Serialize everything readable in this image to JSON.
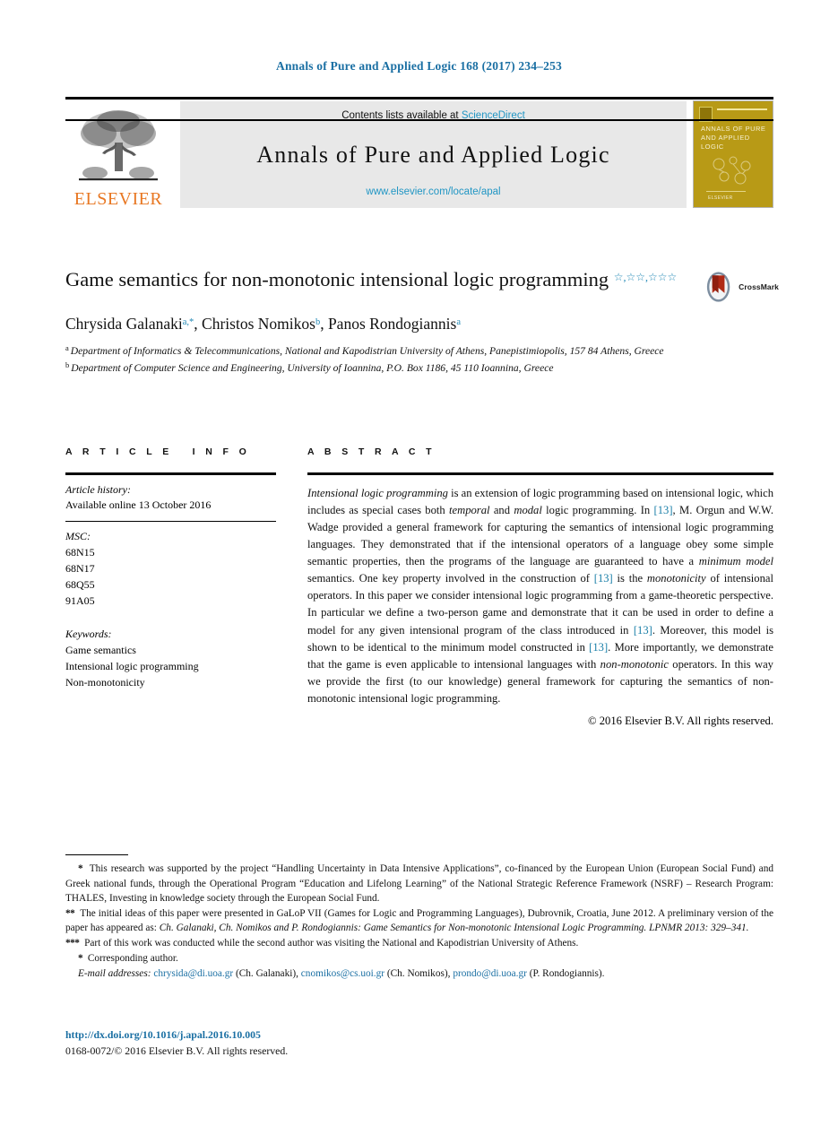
{
  "running_head": "Annals of Pure and Applied Logic 168 (2017) 234–253",
  "masthead": {
    "publisher_logo_name": "elsevier-tree-logo",
    "publisher_word": "ELSEVIER",
    "contents_prefix": "Contents lists available at ",
    "contents_link": "ScienceDirect",
    "journal_name": "Annals of Pure and Applied Logic",
    "journal_url": "www.elsevier.com/locate/apal",
    "cover": {
      "title": "Annals of Pure and Applied Logic",
      "footer_mark": "ELSEVIER",
      "background_color": "#b89a16"
    },
    "accent_link_color": "#2196c4"
  },
  "article": {
    "title": "Game semantics for non-monotonic intensional logic programming",
    "title_footnote_marks": "☆,☆☆,☆☆☆",
    "authors": [
      {
        "name": "Chrysida Galanaki",
        "marks": "a,*"
      },
      {
        "name": "Christos Nomikos",
        "marks": "b"
      },
      {
        "name": "Panos Rondogiannis",
        "marks": "a"
      }
    ],
    "affiliations": [
      {
        "mark": "a",
        "text": "Department of Informatics & Telecommunications, National and Kapodistrian University of Athens, Panepistimiopolis, 157 84 Athens, Greece"
      },
      {
        "mark": "b",
        "text": "Department of Computer Science and Engineering, University of Ioannina, P.O. Box 1186, 45 110 Ioannina, Greece"
      }
    ]
  },
  "crossmark": {
    "label": "CrossMark",
    "icon_name": "crossmark-logo"
  },
  "info_column": {
    "heading": "ARTICLE INFO",
    "history_label": "Article history:",
    "history_value": "Available online 13 October 2016",
    "msc_label": "MSC:",
    "msc_codes": [
      "68N15",
      "68N17",
      "68Q55",
      "91A05"
    ],
    "keywords_label": "Keywords:",
    "keywords": [
      "Game semantics",
      "Intensional logic programming",
      "Non-monotonicity"
    ]
  },
  "abstract_column": {
    "heading": "ABSTRACT",
    "paragraph_html": "<em>Intensional logic programming</em> is an extension of logic programming based on intensional logic, which includes as special cases both <em>temporal</em> and <em>modal</em> logic programming. In <span class=\"ref\">[13]</span>, M. Orgun and W.W. Wadge provided a general framework for capturing the semantics of intensional logic programming languages. They demonstrated that if the intensional operators of a language obey some simple semantic properties, then the programs of the language are guaranteed to have a <em>minimum model</em> semantics. One key property involved in the construction of <span class=\"ref\">[13]</span> is the <em>monotonicity</em> of intensional operators. In this paper we consider intensional logic programming from a game-theoretic perspective. In particular we define a two-person game and demonstrate that it can be used in order to define a model for any given intensional program of the class introduced in <span class=\"ref\">[13]</span>. Moreover, this model is shown to be identical to the minimum model constructed in <span class=\"ref\">[13]</span>. More importantly, we demonstrate that the game is even applicable to intensional languages with <em>non-monotonic</em> operators. In this way we provide the first (to our knowledge) general framework for capturing the semantics of non-monotonic intensional logic programming.",
    "copyright": "© 2016 Elsevier B.V. All rights reserved."
  },
  "footnotes": [
    {
      "mark": "*",
      "html": "This research was supported by the project “Handling Uncertainty in Data Intensive Applications”, co-financed by the European Union (European Social Fund) and Greek national funds, through the Operational Program “Education and Lifelong Learning” of the National Strategic Reference Framework (NSRF) – Research Program: THALES, Investing in knowledge society through the European Social Fund."
    },
    {
      "mark": "**",
      "html": "The initial ideas of this paper were presented in GaLoP VII (Games for Logic and Programming Languages), Dubrovnik, Croatia, June 2012. A preliminary version of the paper has appeared as: <em>Ch. Galanaki, Ch. Nomikos and P. Rondogiannis: Game Semantics for Non-monotonic Intensional Logic Programming. LPNMR 2013: 329–341.</em>"
    },
    {
      "mark": "***",
      "html": "Part of this work was conducted while the second author was visiting the National and Kapodistrian University of Athens."
    },
    {
      "mark": "*",
      "html": "Corresponding author."
    }
  ],
  "emails": {
    "label": "E-mail addresses:",
    "entries": [
      {
        "address": "chrysida@di.uoa.gr",
        "owner": "(Ch. Galanaki)"
      },
      {
        "address": "cnomikos@cs.uoi.gr",
        "owner": "(Ch. Nomikos)"
      },
      {
        "address": "prondo@di.uoa.gr",
        "owner": "(P. Rondogiannis)."
      }
    ]
  },
  "doi": {
    "url": "http://dx.doi.org/10.1016/j.apal.2016.10.005",
    "issn_line": "0168-0072/© 2016 Elsevier B.V. All rights reserved."
  }
}
